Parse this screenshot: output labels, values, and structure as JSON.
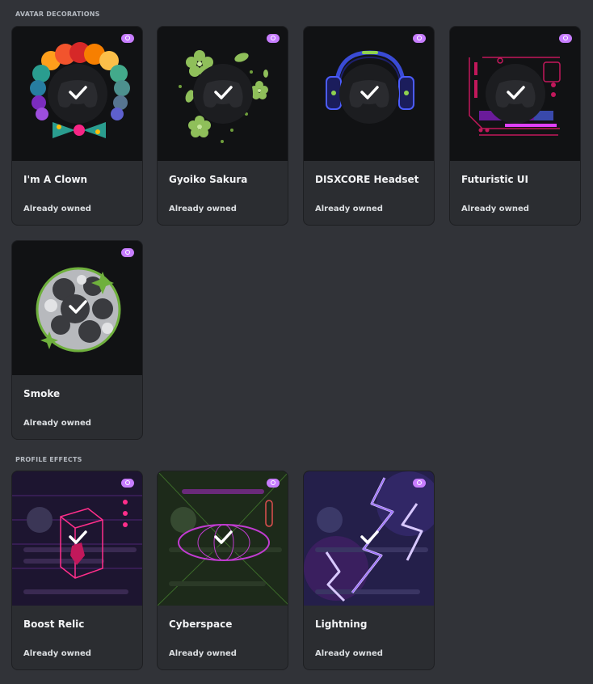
{
  "sections": {
    "avatar_decorations": "AVATAR DECORATIONS",
    "profile_effects": "PROFILE EFFECTS"
  },
  "avatar_decorations": [
    {
      "name": "I'm A Clown",
      "status": "Already owned",
      "icon": "clown-decoration"
    },
    {
      "name": "Gyoiko Sakura",
      "status": "Already owned",
      "icon": "sakura-decoration"
    },
    {
      "name": "DISXCORE Headset",
      "status": "Already owned",
      "icon": "headset-decoration"
    },
    {
      "name": "Futuristic UI",
      "status": "Already owned",
      "icon": "futuristic-ui-decoration"
    },
    {
      "name": "Smoke",
      "status": "Already owned",
      "icon": "smoke-decoration"
    }
  ],
  "profile_effects": [
    {
      "name": "Boost Relic",
      "status": "Already owned",
      "icon": "boost-relic-effect"
    },
    {
      "name": "Cyberspace",
      "status": "Already owned",
      "icon": "cyberspace-effect"
    },
    {
      "name": "Lightning",
      "status": "Already owned",
      "icon": "lightning-effect"
    }
  ],
  "colors": {
    "background": "#313338",
    "card": "#2b2d31",
    "nitro": "#c77dff"
  }
}
